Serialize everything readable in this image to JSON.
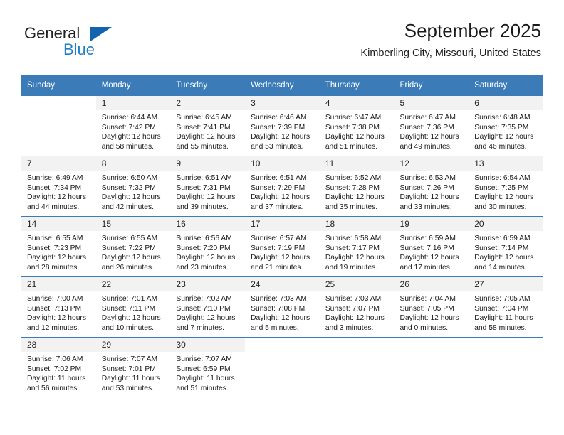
{
  "brand": {
    "name_top": "General",
    "name_bottom": "Blue",
    "accent_color": "#1f7ec4",
    "triangle_color": "#1463ad"
  },
  "header": {
    "title": "September 2025",
    "location": "Kimberling City, Missouri, United States"
  },
  "calendar": {
    "header_bg": "#3b7cb8",
    "daynum_bg": "#f2f2f2",
    "weekday_headers": [
      "Sunday",
      "Monday",
      "Tuesday",
      "Wednesday",
      "Thursday",
      "Friday",
      "Saturday"
    ],
    "labels": {
      "sunrise": "Sunrise:",
      "sunset": "Sunset:",
      "daylight": "Daylight:"
    },
    "weeks": [
      [
        {
          "day": "",
          "blank": true
        },
        {
          "day": "1",
          "sunrise": "Sunrise: 6:44 AM",
          "sunset": "Sunset: 7:42 PM",
          "daylight_1": "Daylight: 12 hours",
          "daylight_2": "and 58 minutes."
        },
        {
          "day": "2",
          "sunrise": "Sunrise: 6:45 AM",
          "sunset": "Sunset: 7:41 PM",
          "daylight_1": "Daylight: 12 hours",
          "daylight_2": "and 55 minutes."
        },
        {
          "day": "3",
          "sunrise": "Sunrise: 6:46 AM",
          "sunset": "Sunset: 7:39 PM",
          "daylight_1": "Daylight: 12 hours",
          "daylight_2": "and 53 minutes."
        },
        {
          "day": "4",
          "sunrise": "Sunrise: 6:47 AM",
          "sunset": "Sunset: 7:38 PM",
          "daylight_1": "Daylight: 12 hours",
          "daylight_2": "and 51 minutes."
        },
        {
          "day": "5",
          "sunrise": "Sunrise: 6:47 AM",
          "sunset": "Sunset: 7:36 PM",
          "daylight_1": "Daylight: 12 hours",
          "daylight_2": "and 49 minutes."
        },
        {
          "day": "6",
          "sunrise": "Sunrise: 6:48 AM",
          "sunset": "Sunset: 7:35 PM",
          "daylight_1": "Daylight: 12 hours",
          "daylight_2": "and 46 minutes."
        }
      ],
      [
        {
          "day": "7",
          "sunrise": "Sunrise: 6:49 AM",
          "sunset": "Sunset: 7:34 PM",
          "daylight_1": "Daylight: 12 hours",
          "daylight_2": "and 44 minutes."
        },
        {
          "day": "8",
          "sunrise": "Sunrise: 6:50 AM",
          "sunset": "Sunset: 7:32 PM",
          "daylight_1": "Daylight: 12 hours",
          "daylight_2": "and 42 minutes."
        },
        {
          "day": "9",
          "sunrise": "Sunrise: 6:51 AM",
          "sunset": "Sunset: 7:31 PM",
          "daylight_1": "Daylight: 12 hours",
          "daylight_2": "and 39 minutes."
        },
        {
          "day": "10",
          "sunrise": "Sunrise: 6:51 AM",
          "sunset": "Sunset: 7:29 PM",
          "daylight_1": "Daylight: 12 hours",
          "daylight_2": "and 37 minutes."
        },
        {
          "day": "11",
          "sunrise": "Sunrise: 6:52 AM",
          "sunset": "Sunset: 7:28 PM",
          "daylight_1": "Daylight: 12 hours",
          "daylight_2": "and 35 minutes."
        },
        {
          "day": "12",
          "sunrise": "Sunrise: 6:53 AM",
          "sunset": "Sunset: 7:26 PM",
          "daylight_1": "Daylight: 12 hours",
          "daylight_2": "and 33 minutes."
        },
        {
          "day": "13",
          "sunrise": "Sunrise: 6:54 AM",
          "sunset": "Sunset: 7:25 PM",
          "daylight_1": "Daylight: 12 hours",
          "daylight_2": "and 30 minutes."
        }
      ],
      [
        {
          "day": "14",
          "sunrise": "Sunrise: 6:55 AM",
          "sunset": "Sunset: 7:23 PM",
          "daylight_1": "Daylight: 12 hours",
          "daylight_2": "and 28 minutes."
        },
        {
          "day": "15",
          "sunrise": "Sunrise: 6:55 AM",
          "sunset": "Sunset: 7:22 PM",
          "daylight_1": "Daylight: 12 hours",
          "daylight_2": "and 26 minutes."
        },
        {
          "day": "16",
          "sunrise": "Sunrise: 6:56 AM",
          "sunset": "Sunset: 7:20 PM",
          "daylight_1": "Daylight: 12 hours",
          "daylight_2": "and 23 minutes."
        },
        {
          "day": "17",
          "sunrise": "Sunrise: 6:57 AM",
          "sunset": "Sunset: 7:19 PM",
          "daylight_1": "Daylight: 12 hours",
          "daylight_2": "and 21 minutes."
        },
        {
          "day": "18",
          "sunrise": "Sunrise: 6:58 AM",
          "sunset": "Sunset: 7:17 PM",
          "daylight_1": "Daylight: 12 hours",
          "daylight_2": "and 19 minutes."
        },
        {
          "day": "19",
          "sunrise": "Sunrise: 6:59 AM",
          "sunset": "Sunset: 7:16 PM",
          "daylight_1": "Daylight: 12 hours",
          "daylight_2": "and 17 minutes."
        },
        {
          "day": "20",
          "sunrise": "Sunrise: 6:59 AM",
          "sunset": "Sunset: 7:14 PM",
          "daylight_1": "Daylight: 12 hours",
          "daylight_2": "and 14 minutes."
        }
      ],
      [
        {
          "day": "21",
          "sunrise": "Sunrise: 7:00 AM",
          "sunset": "Sunset: 7:13 PM",
          "daylight_1": "Daylight: 12 hours",
          "daylight_2": "and 12 minutes."
        },
        {
          "day": "22",
          "sunrise": "Sunrise: 7:01 AM",
          "sunset": "Sunset: 7:11 PM",
          "daylight_1": "Daylight: 12 hours",
          "daylight_2": "and 10 minutes."
        },
        {
          "day": "23",
          "sunrise": "Sunrise: 7:02 AM",
          "sunset": "Sunset: 7:10 PM",
          "daylight_1": "Daylight: 12 hours",
          "daylight_2": "and 7 minutes."
        },
        {
          "day": "24",
          "sunrise": "Sunrise: 7:03 AM",
          "sunset": "Sunset: 7:08 PM",
          "daylight_1": "Daylight: 12 hours",
          "daylight_2": "and 5 minutes."
        },
        {
          "day": "25",
          "sunrise": "Sunrise: 7:03 AM",
          "sunset": "Sunset: 7:07 PM",
          "daylight_1": "Daylight: 12 hours",
          "daylight_2": "and 3 minutes."
        },
        {
          "day": "26",
          "sunrise": "Sunrise: 7:04 AM",
          "sunset": "Sunset: 7:05 PM",
          "daylight_1": "Daylight: 12 hours",
          "daylight_2": "and 0 minutes."
        },
        {
          "day": "27",
          "sunrise": "Sunrise: 7:05 AM",
          "sunset": "Sunset: 7:04 PM",
          "daylight_1": "Daylight: 11 hours",
          "daylight_2": "and 58 minutes."
        }
      ],
      [
        {
          "day": "28",
          "sunrise": "Sunrise: 7:06 AM",
          "sunset": "Sunset: 7:02 PM",
          "daylight_1": "Daylight: 11 hours",
          "daylight_2": "and 56 minutes."
        },
        {
          "day": "29",
          "sunrise": "Sunrise: 7:07 AM",
          "sunset": "Sunset: 7:01 PM",
          "daylight_1": "Daylight: 11 hours",
          "daylight_2": "and 53 minutes."
        },
        {
          "day": "30",
          "sunrise": "Sunrise: 7:07 AM",
          "sunset": "Sunset: 6:59 PM",
          "daylight_1": "Daylight: 11 hours",
          "daylight_2": "and 51 minutes."
        },
        {
          "day": "",
          "blank": true
        },
        {
          "day": "",
          "blank": true
        },
        {
          "day": "",
          "blank": true
        },
        {
          "day": "",
          "blank": true
        }
      ]
    ]
  }
}
